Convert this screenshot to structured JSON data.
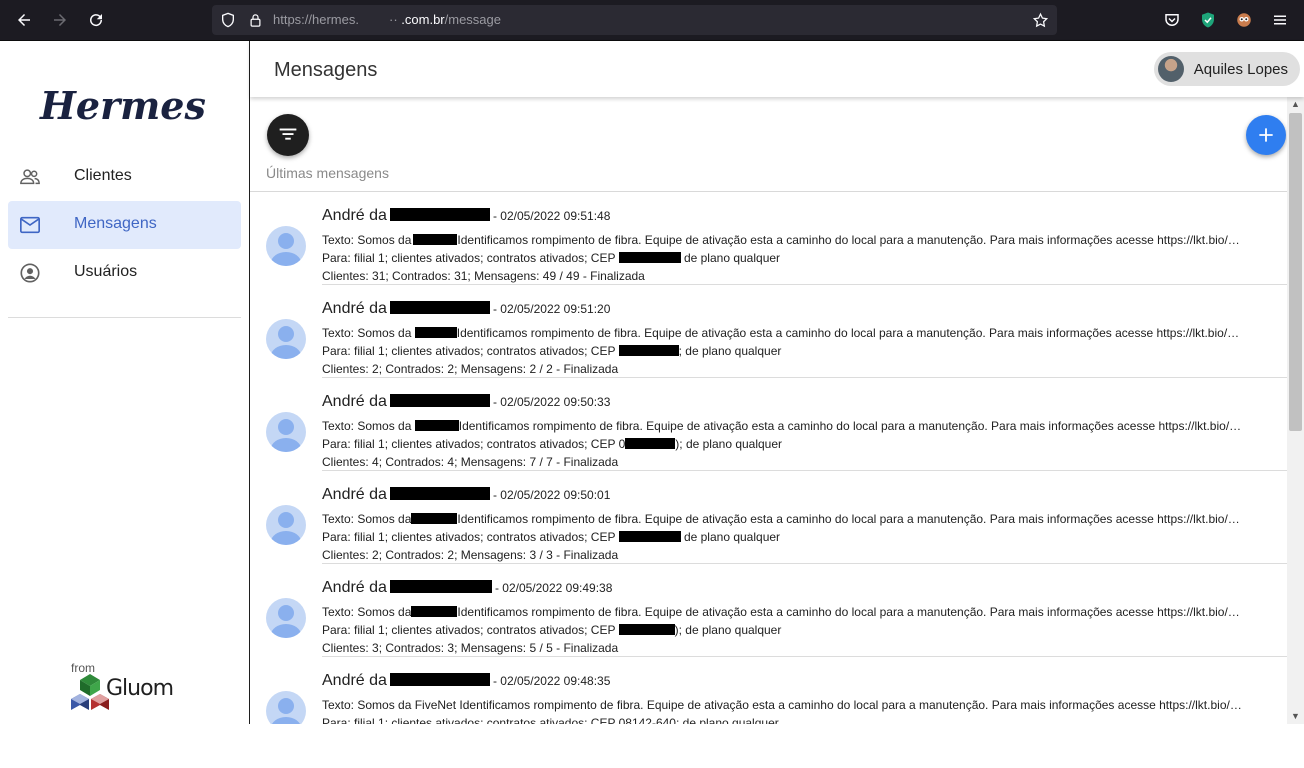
{
  "browser": {
    "url_prefix": "https://hermes.",
    "url_mid": "··",
    "url_domain": ".com.br",
    "url_path": "/message"
  },
  "sidebar": {
    "logo": "Hermes",
    "items": [
      {
        "label": "Clientes",
        "icon": "people-icon"
      },
      {
        "label": "Mensagens",
        "icon": "mail-icon",
        "active": true
      },
      {
        "label": "Usuários",
        "icon": "account-circle-icon"
      }
    ],
    "footer_from": "from",
    "footer_brand": "Gluom"
  },
  "header": {
    "title": "Mensagens",
    "user_name": "Aquiles Lopes"
  },
  "content": {
    "section_label": "Últimas mensagens"
  },
  "colors": {
    "accent": "#2f7ef0",
    "active_nav_bg": "#e1eafc",
    "active_nav_text": "#3f66c4"
  },
  "messages": [
    {
      "sender": "André da",
      "date": "- 02/05/2022 09:51:48",
      "text_pre": "Texto: Somos da",
      "text_post": "Identificamos rompimento de fibra. Equipe de ativação esta a caminho do local para a manutenção. Para mais informações acesse https://lkt.bio/…",
      "para_pre": "Para: filial 1; clientes ativados; contratos ativados; CEP",
      "para_post": "de plano qualquer",
      "stats": "Clientes: 31; Contrados: 31; Mensagens: 49 / 49  - Finalizada"
    },
    {
      "sender": "André da",
      "date": "- 02/05/2022 09:51:20",
      "text_pre": "Texto: Somos da",
      "text_post": "Identificamos rompimento de fibra. Equipe de ativação esta a caminho do local para a manutenção. Para mais informações acesse https://lkt.bio/…",
      "para_pre": "Para: filial 1; clientes ativados; contratos ativados; CEP",
      "para_post": "; de plano qualquer",
      "stats": "Clientes: 2; Contrados: 2; Mensagens: 2 / 2  - Finalizada"
    },
    {
      "sender": "André da",
      "date": "- 02/05/2022 09:50:33",
      "text_pre": "Texto: Somos da",
      "text_post": "Identificamos rompimento de fibra. Equipe de ativação esta a caminho do local para a manutenção. Para mais informações acesse https://lkt.bio/…",
      "para_pre": "Para: filial 1; clientes ativados; contratos ativados; CEP 0",
      "para_post": "); de plano qualquer",
      "stats": "Clientes: 4; Contrados: 4; Mensagens: 7 / 7  - Finalizada"
    },
    {
      "sender": "André da",
      "date": "- 02/05/2022 09:50:01",
      "text_pre": "Texto: Somos da",
      "text_post": "Identificamos rompimento de fibra. Equipe de ativação esta a caminho do local para a manutenção. Para mais informações acesse https://lkt.bio/…",
      "para_pre": "Para: filial 1; clientes ativados; contratos ativados; CEP",
      "para_post": "de plano qualquer",
      "stats": "Clientes: 2; Contrados: 2; Mensagens: 3 / 3  - Finalizada"
    },
    {
      "sender": "André da",
      "date": "- 02/05/2022 09:49:38",
      "text_pre": "Texto: Somos da",
      "text_post": "Identificamos rompimento de fibra. Equipe de ativação esta a caminho do local para a manutenção. Para mais informações acesse https://lkt.bio/…",
      "para_pre": "Para: filial 1; clientes ativados; contratos ativados; CEP",
      "para_post": "); de plano qualquer",
      "stats": "Clientes: 3; Contrados: 3; Mensagens: 5 / 5  - Finalizada"
    },
    {
      "sender": "André da",
      "date": "- 02/05/2022 09:48:35",
      "text_pre": "Texto: Somos da FiveNet",
      "text_post": "Identificamos rompimento de fibra. Equipe de ativação esta a caminho do local para a manutenção. Para mais informações acesse https://lkt.bio/…",
      "para_pre": "Para: filial 1; clientes ativados; contratos ativados; CEP 08142-640; de plano qualquer",
      "para_post": "",
      "stats": ""
    }
  ]
}
